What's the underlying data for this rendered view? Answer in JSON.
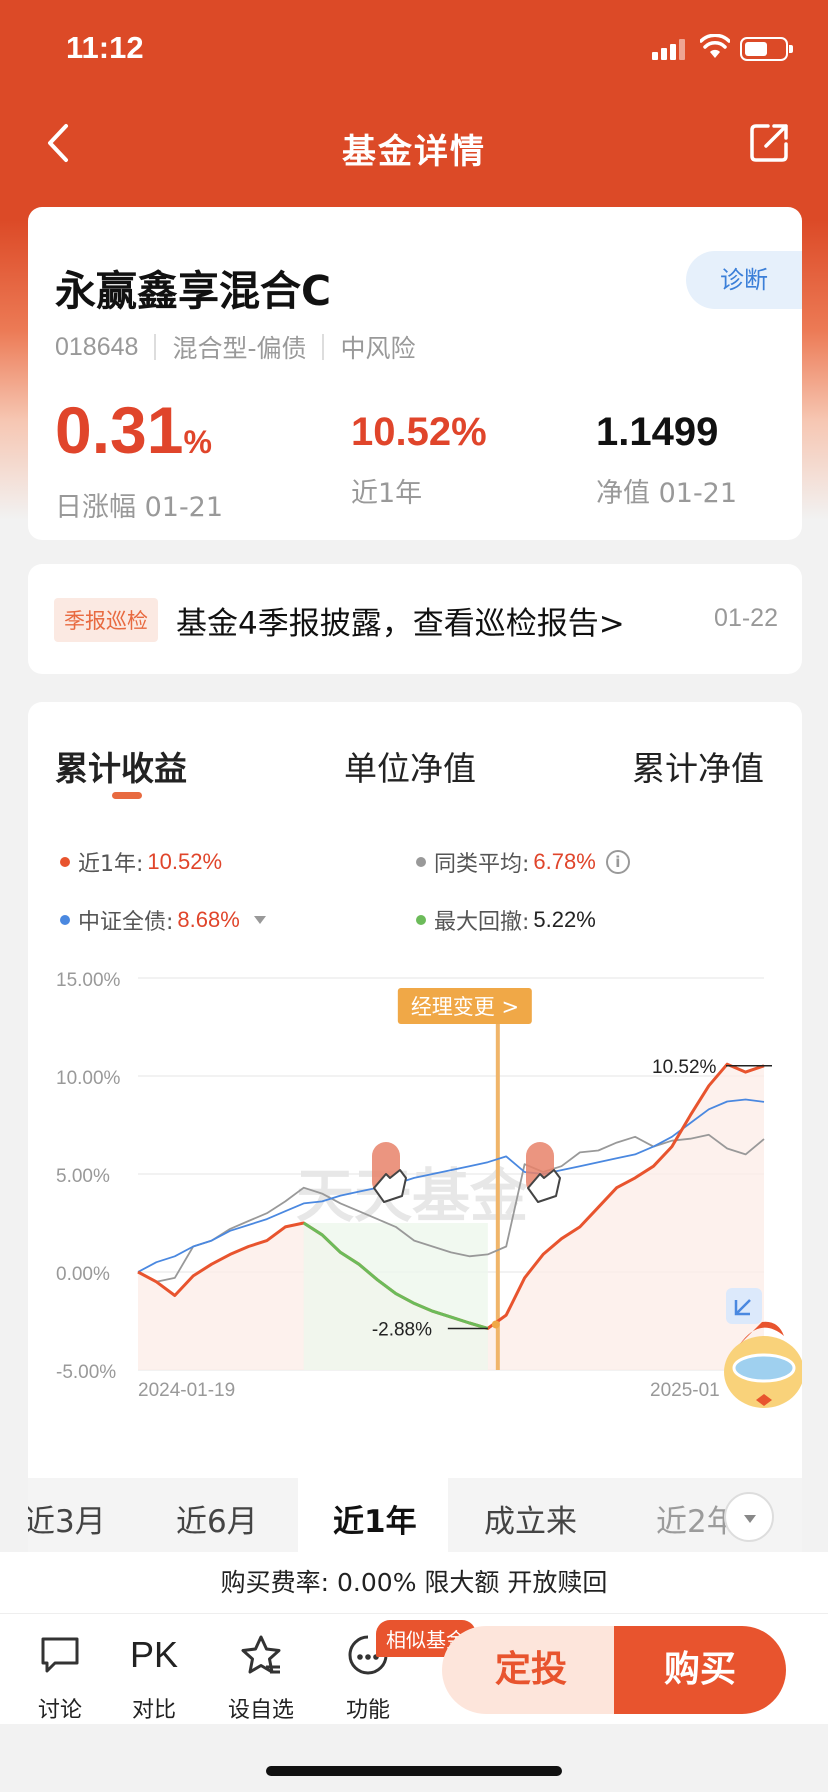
{
  "status": {
    "time": "11:12"
  },
  "nav": {
    "title": "基金详情"
  },
  "fund": {
    "name": "永赢鑫享混合C",
    "diagnose": "诊断",
    "code": "018648",
    "type": "混合型-偏债",
    "risk": "中风险",
    "daily_change": "0.31",
    "daily_unit": "%",
    "daily_label": "日涨幅 01-21",
    "year_return": "10.52%",
    "year_label": "近1年",
    "nav_value": "1.1499",
    "nav_label": "净值 01-21"
  },
  "notice": {
    "tag": "季报巡检",
    "text": "基金4季报披露，查看巡检报告>",
    "date": "01-22"
  },
  "chart_tabs": [
    "累计收益",
    "单位净值",
    "累计净值"
  ],
  "legend": {
    "fund": {
      "name": "近1年:",
      "value": "10.52%",
      "color": "#e8542e"
    },
    "peer": {
      "name": "同类平均:",
      "value": "6.78%",
      "color": "#999999"
    },
    "index": {
      "name": "中证全债:",
      "value": "8.68%",
      "color": "#4a88e0"
    },
    "drawdown": {
      "name": "最大回撤:",
      "value": "5.22%",
      "color": "#6cbb5a"
    }
  },
  "chart_data": {
    "type": "line",
    "ylim": [
      -5,
      15
    ],
    "y_ticks": [
      "15.00%",
      "10.00%",
      "5.00%",
      "0.00%",
      "-5.00%"
    ],
    "x_ticks": [
      "2024-01-19",
      "2025-01"
    ],
    "marker_label": "经理变更 >",
    "max_label": "10.52%",
    "min_label": "-2.88%",
    "watermark": "天天基金",
    "series": [
      {
        "name": "近1年",
        "color": "#e8542e",
        "values": [
          0,
          -0.5,
          -1.2,
          -0.2,
          0.4,
          0.9,
          1.3,
          1.6,
          2.3,
          2.5,
          1.9,
          1.0,
          0.4,
          -0.4,
          -1.1,
          -1.6,
          -2.0,
          -2.3,
          -2.6,
          -2.88,
          -2.2,
          -0.3,
          0.9,
          1.7,
          2.3,
          3.3,
          4.3,
          4.8,
          5.4,
          6.4,
          8.0,
          9.5,
          10.6,
          10.2,
          10.52
        ]
      },
      {
        "name": "同类平均",
        "color": "#999999",
        "values": [
          0,
          -0.5,
          -0.3,
          1.3,
          1.6,
          2.2,
          2.6,
          3.0,
          3.6,
          4.3,
          4.0,
          3.5,
          3.1,
          2.7,
          2.3,
          1.6,
          1.3,
          1.0,
          0.8,
          0.9,
          1.3,
          5.5,
          5.1,
          5.4,
          6.1,
          6.2,
          6.6,
          6.9,
          6.4,
          6.7,
          6.8,
          7.0,
          6.3,
          6.0,
          6.78
        ]
      },
      {
        "name": "中证全债",
        "color": "#4a88e0",
        "values": [
          0,
          0.5,
          0.8,
          1.3,
          1.6,
          2.1,
          2.4,
          2.7,
          3.1,
          3.5,
          3.6,
          3.9,
          4.1,
          4.3,
          4.5,
          4.8,
          5.0,
          5.2,
          5.4,
          5.6,
          5.9,
          5.1,
          5.0,
          5.2,
          5.4,
          5.6,
          5.8,
          6.0,
          6.4,
          6.9,
          7.6,
          8.3,
          8.7,
          8.8,
          8.68
        ]
      }
    ],
    "drawdown_range": [
      9,
      19
    ]
  },
  "ranges": [
    "近3月",
    "近6月",
    "近1年",
    "成立来",
    "近2年"
  ],
  "range_active": "近1年",
  "fee": "购买费率: 0.00% 限大额 开放赎回",
  "bottom": {
    "discuss": "讨论",
    "pk": "PK",
    "compare": "对比",
    "watch": "设自选",
    "func": "功能",
    "similar": "相似基金",
    "invest": "定投",
    "buy": "购买"
  }
}
